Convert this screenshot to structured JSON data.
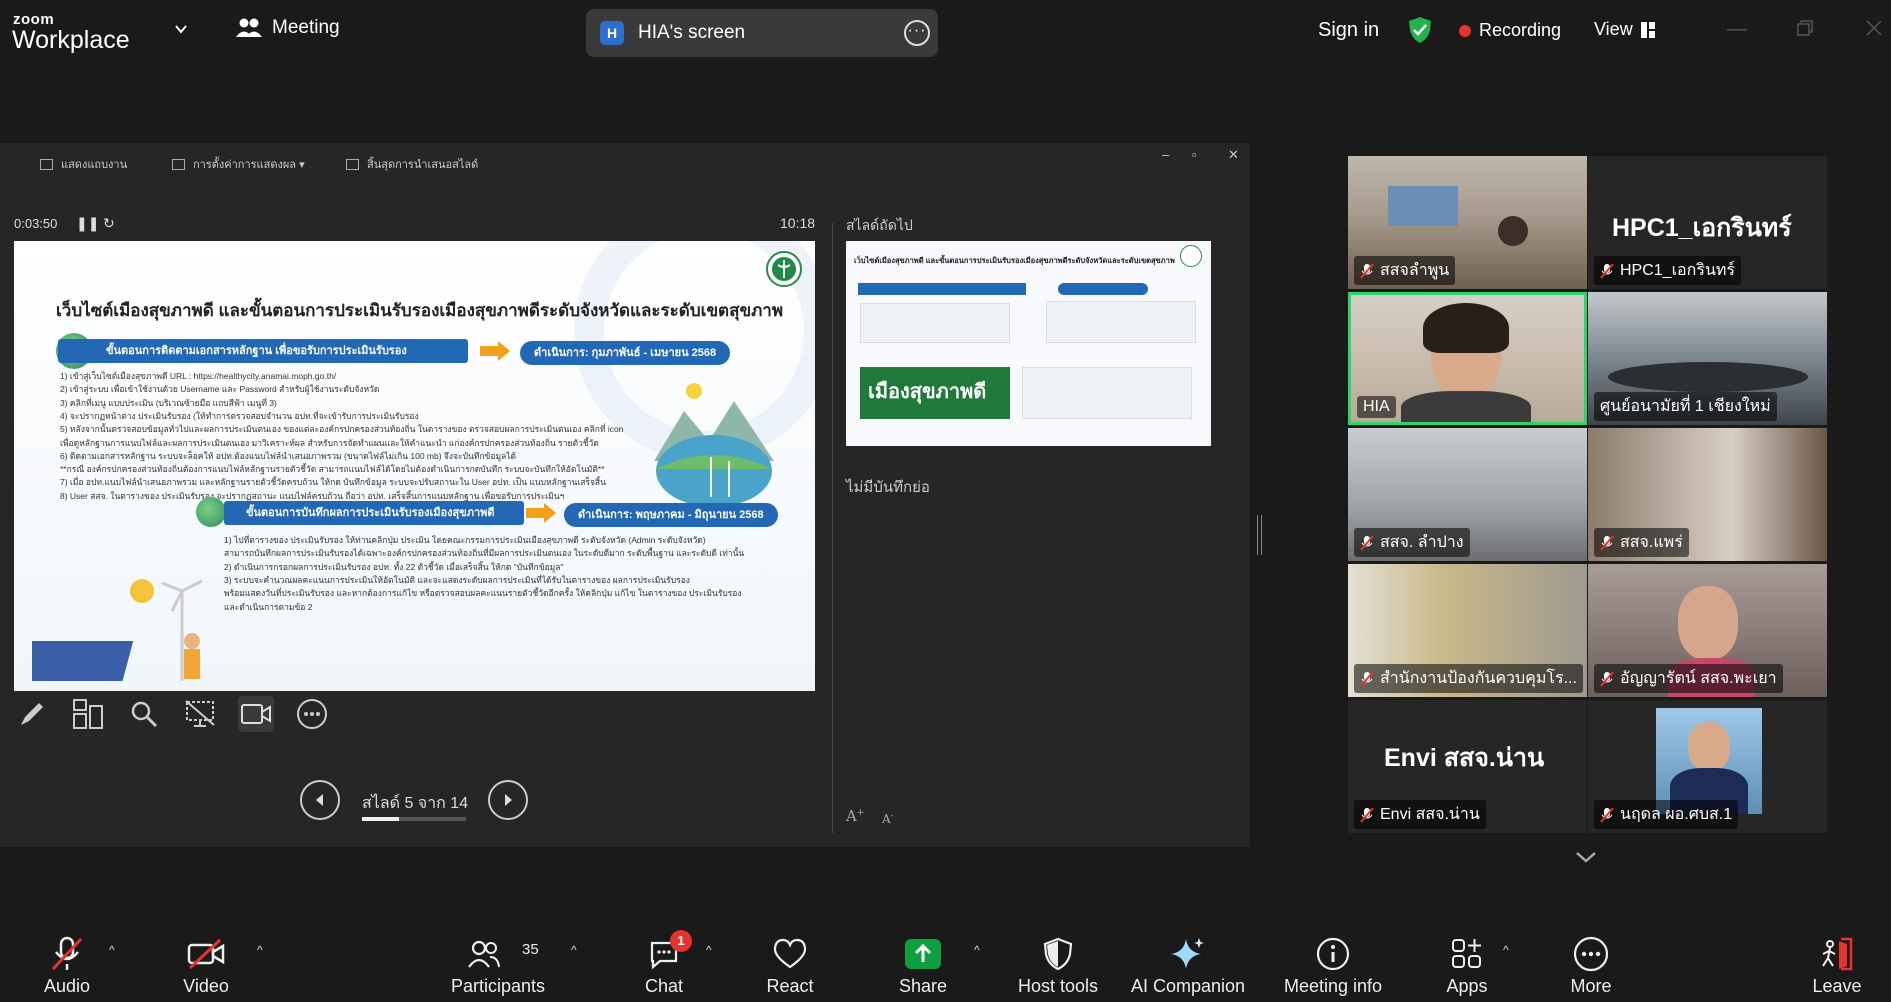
{
  "app": {
    "brand_top": "zoom",
    "brand_bottom": "Workplace"
  },
  "header": {
    "meeting_label": "Meeting",
    "screen_share": {
      "badge": "H",
      "label": "HIA's screen"
    },
    "sign_in": "Sign in",
    "recording": "Recording",
    "view": "View"
  },
  "presentation": {
    "toolbar": [
      "แสดงแถบงาน",
      "การตั้งค่าการแสดงผล ▾",
      "สิ้นสุดการนำเสนอสไลด์"
    ],
    "elapsed": "0:03:50",
    "clock": "10:18",
    "next_slide_label": "สไลด์ถัดไป",
    "no_notes": "ไม่มีบันทึกย่อ",
    "slide_counter": "สไลด์ 5 จาก 14",
    "progress_fraction": 0.357,
    "slide": {
      "title": "เว็บไซต์เมืองสุขภาพดี และขั้นตอนการประเมินรับรองเมืองสุขภาพดีระดับจังหวัดและระดับเขตสุขภาพ",
      "section1": "ขั้นตอนการติดตามเอกสารหลักฐาน เพื่อขอรับการประเมินรับรอง",
      "date1": "ดำเนินการ: กุมภาพันธ์ - เมษายน 2568",
      "lines1": [
        "1) เข้าสู่เว็บไซต์เมืองสุขภาพดี URL : https://healthycity.anamai.moph.go.th/",
        "2) เข้าสู่ระบบ เพื่อเข้าใช้งานด้วย Username และ Password สำหรับผู้ใช้งานระดับจังหวัด",
        "3) คลิกที่เมนู แบบประเมิน (บริเวณซ้ายมือ แถบสีฟ้า เมนูที่ 3)",
        "4) จะปรากฏหน้าต่าง ประเมินรับรอง (ให้ทำการตรวจสอบจำนวน อปท.ที่จะเข้ารับการประเมินรับรอง",
        "5) หลังจากนั้นตรวจสอบข้อมูลทั่วไปและผลการประเมินตนเอง ของแต่ละองค์กรปกครองส่วนท้องถิ่น ในตารางของ ตรวจสอบผลการประเมินตนเอง คลิกที่ icon",
        "    เพื่อดูหลักฐานการแนบไฟล์และผลการประเมินตนเอง มาวิเคราะห์ผล สำหรับการจัดทำแผนและให้คำแนะนำ แก่องค์กรปกครองส่วนท้องถิ่น รายตัวชี้วัด",
        "6) ติดตามเอกสารหลักฐาน ระบบจะล็อคให้ อปท.ต้องแนบไฟล์นำเสนอภาพรวม (ขนาดไฟล์ไม่เกิน 100 mb) จึงจะบันทึกข้อมูลได้",
        "**กรณี องค์กรปกครองส่วนท้องถิ่นต้องการแนบไฟล์หลักฐานรายตัวชี้วัด สามารถแนบไฟล์ได้โดยไม่ต้องดำเนินการกดบันทึก ระบบจะบันทึกให้อัตโนมัติ**",
        "7) เมื่อ อปท.แนบไฟล์นำเสนอภาพรวม และหลักฐานรายตัวชี้วัดครบถ้วน ให้กด บันทึกข้อมูล ระบบจะปรับสถานะใน User อปท. เป็น แนบหลักฐานเสร็จสิ้น",
        "8) User สสจ. ในตารางของ ประเมินรับรอง จะปรากฏสถานะ แนบไฟล์ครบถ้วน ถือว่า อปท. เสร็จสิ้นการแนบหลักฐาน เพื่อขอรับการประเมินฯ"
      ],
      "section2": "ขั้นตอนการบันทึกผลการประเมินรับรองเมืองสุขภาพดี",
      "date2": "ดำเนินการ: พฤษภาคม - มิถุนายน 2568",
      "lines2": [
        "1) ไปที่ตารางของ ประเมินรับรอง ให้ท่านคลิกปุ่ม ประเมิน โดยคณะกรรมการประเมินเมืองสุขภาพดี ระดับจังหวัด (Admin ระดับจังหวัด)",
        "    สามารถบันทึกผลการประเมินรับรองได้เฉพาะองค์กรปกครองส่วนท้องถิ่นที่มีผลการประเมินตนเอง ในระดับดีมาก ระดับพื้นฐาน และระดับดี เท่านั้น",
        "2) ดำเนินการกรอกผลการประเมินรับรอง อปท. ทั้ง 22 ตัวชี้วัด เมื่อเสร็จสิ้น ให้กด \"บันทึกข้อมูล\"",
        "3) ระบบจะคำนวณผลคะแนนการประเมินให้อัตโนมัติ และจะแสดงระดับผลการประเมินที่ได้รับในตารางของ ผลการประเมินรับรอง",
        "    พร้อมแสดงวันที่ประเมินรับรอง และหากต้องการแก้ไข หรือตรวจสอบผลคะแนนรายตัวชี้วัดอีกครั้ง ให้คลิกปุ่ม แก้ไข ในตารางของ ประเมินรับรอง",
        "    และดำเนินการตามข้อ 2"
      ],
      "next_title": "เว็บไซต์เมืองสุขภาพดี และขั้นตอนการประเมินรับรองเมืองสุขภาพดีระดับจังหวัดและระดับเขตสุขภาพ",
      "next_banner": "เมืองสุขภาพดี"
    }
  },
  "gallery": {
    "tiles": [
      {
        "name": "สสจลำพูน"
      },
      {
        "name": "HPC1_เอกรินทร์",
        "big": "HPC1_เอกรินทร์"
      },
      {
        "name": "HIA"
      },
      {
        "name": "ศูนย์อนามัยที่ 1 เชียงใหม่"
      },
      {
        "name": "สสจ. ลำปาง"
      },
      {
        "name": "สสจ.แพร่"
      },
      {
        "name": "สำนักงานป้องกันควบคุมโร..."
      },
      {
        "name": "อัญญารัตน์ สสจ.พะเยา"
      },
      {
        "name": "Envi สสจ.น่าน",
        "big": "Envi สสจ.น่าน"
      },
      {
        "name": "นฤดล ผอ.ศบส.1"
      }
    ]
  },
  "toolbar": {
    "audio": "Audio",
    "video": "Video",
    "participants": "Participants",
    "participants_count": "35",
    "chat": "Chat",
    "chat_badge": "1",
    "react": "React",
    "share": "Share",
    "host_tools": "Host tools",
    "ai_companion": "AI Companion",
    "meeting_info": "Meeting info",
    "apps": "Apps",
    "more": "More",
    "leave": "Leave"
  },
  "colors": {
    "share_green": "#0e9f3f",
    "speaker_border": "#2fd46b",
    "recording_red": "#e5342b",
    "mute_red": "#e5342b"
  }
}
